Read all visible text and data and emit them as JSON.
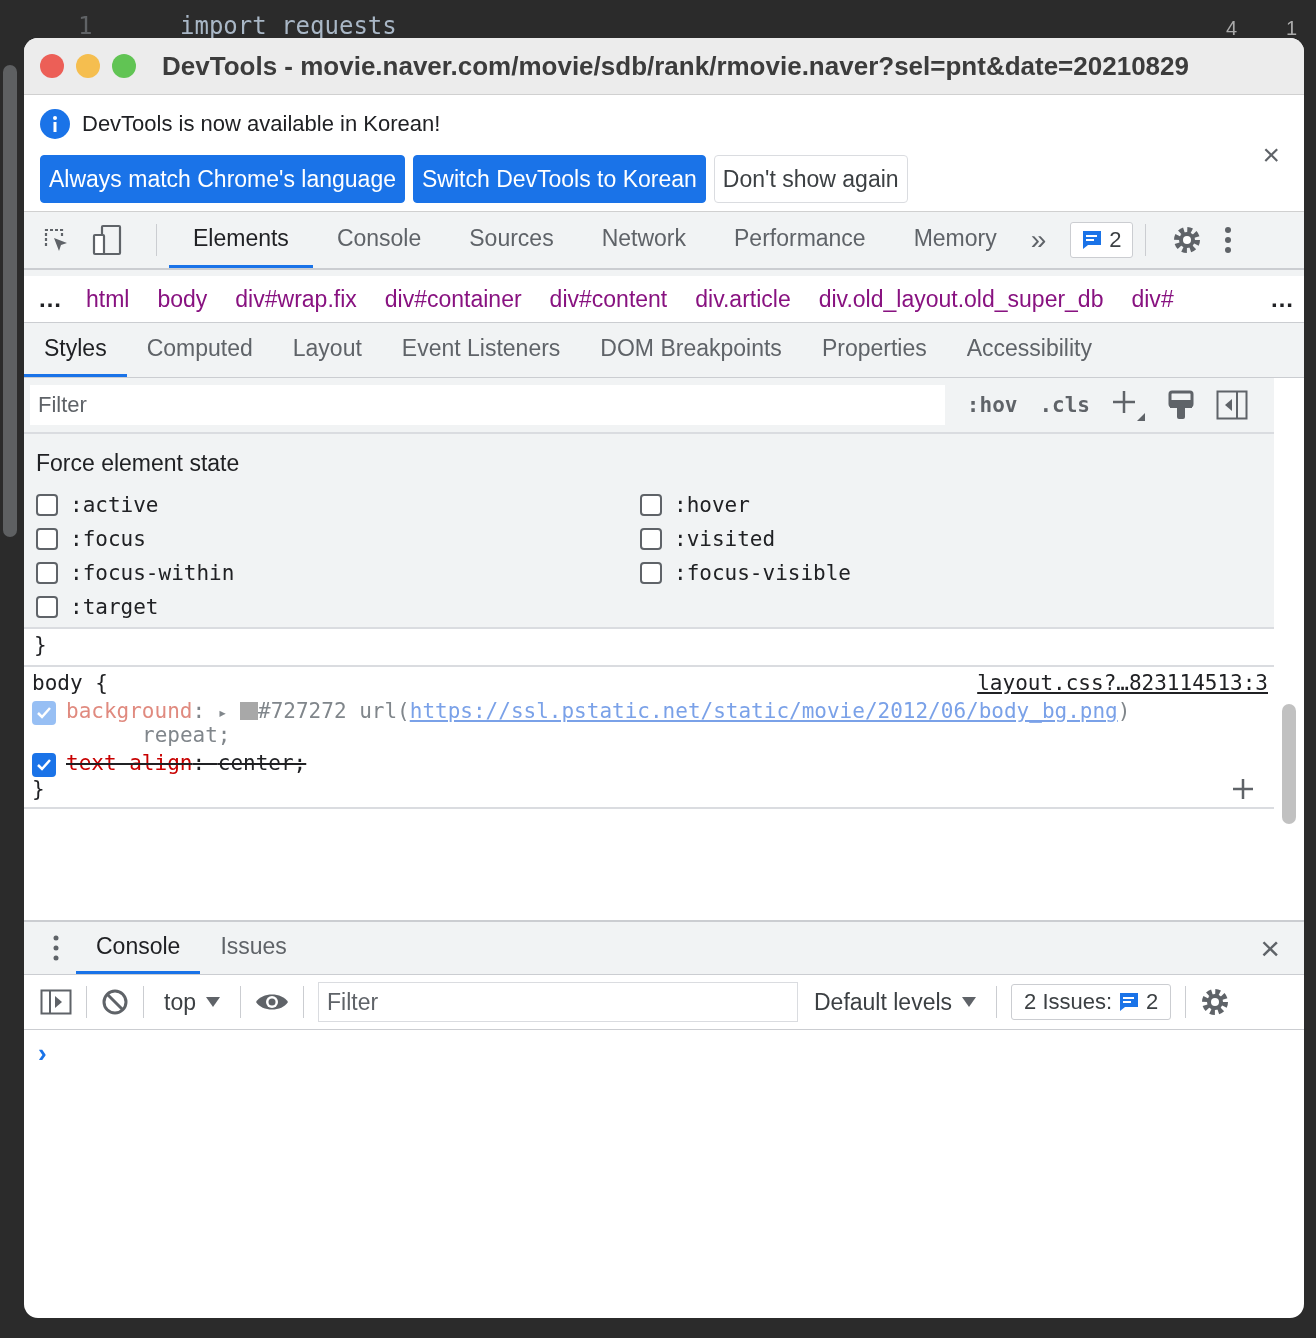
{
  "editor": {
    "line_number": "1",
    "code_top": "import requests",
    "warnings": "4",
    "checks": "1"
  },
  "window": {
    "title": "DevTools - movie.naver.com/movie/sdb/rank/rmovie.naver?sel=pnt&date=20210829"
  },
  "infobar": {
    "message": "DevTools is now available in Korean!",
    "buttons": [
      {
        "label": "Always match Chrome's language",
        "kind": "primary"
      },
      {
        "label": "Switch DevTools to Korean",
        "kind": "primary"
      },
      {
        "label": "Don't show again",
        "kind": "secondary"
      }
    ],
    "close": "×"
  },
  "tabs": [
    {
      "label": "Elements",
      "selected": true
    },
    {
      "label": "Console",
      "selected": false
    },
    {
      "label": "Sources",
      "selected": false
    },
    {
      "label": "Network",
      "selected": false
    },
    {
      "label": "Performance",
      "selected": false
    },
    {
      "label": "Memory",
      "selected": false
    }
  ],
  "tabs_more": "»",
  "issues_badge": "2",
  "breadcrumbs": {
    "more_left": "…",
    "more_right": "…",
    "items": [
      {
        "tag": "html"
      },
      {
        "tag": "body"
      },
      {
        "tag": "div",
        "rest": "#wrap.fix"
      },
      {
        "tag": "div",
        "rest": "#container"
      },
      {
        "tag": "div",
        "rest": "#content"
      },
      {
        "tag": "div",
        "rest": ".article"
      },
      {
        "tag": "div",
        "rest": ".old_layout.old_super_db"
      },
      {
        "tag": "div",
        "rest": "#"
      }
    ]
  },
  "subtabs": [
    {
      "label": "Styles",
      "selected": true
    },
    {
      "label": "Computed",
      "selected": false
    },
    {
      "label": "Layout",
      "selected": false
    },
    {
      "label": "Event Listeners",
      "selected": false
    },
    {
      "label": "DOM Breakpoints",
      "selected": false
    },
    {
      "label": "Properties",
      "selected": false
    },
    {
      "label": "Accessibility",
      "selected": false
    }
  ],
  "styles_toolbar": {
    "filter_placeholder": "Filter",
    "hov": ":hov",
    "cls": ".cls"
  },
  "force_state": {
    "title": "Force element state",
    "states": [
      {
        "label": ":active",
        "checked": false
      },
      {
        "label": ":hover",
        "checked": false
      },
      {
        "label": ":focus",
        "checked": false
      },
      {
        "label": ":visited",
        "checked": false
      },
      {
        "label": ":focus-within",
        "checked": false
      },
      {
        "label": ":focus-visible",
        "checked": false
      },
      {
        "label": ":target",
        "checked": false
      }
    ]
  },
  "rules": {
    "previous_close": "}",
    "selector": "body {",
    "source": "layout.css?…823114513:3",
    "properties": [
      {
        "kind": "color",
        "name": "background",
        "separator": ":",
        "expander": "▸",
        "value_before": "#727272 url(",
        "link": "https://ssl.pstatic.net/static/movie/2012/06/body_bg.png",
        "value_after": ")",
        "continuation": "repeat;",
        "checked": true,
        "inactive": true,
        "overridden": false
      },
      {
        "kind": "plain",
        "name": "text-align",
        "separator": ":",
        "value_before": "center;",
        "checked": true,
        "inactive": false,
        "overridden": true
      }
    ],
    "close": "}"
  },
  "drawer": {
    "tabs": [
      {
        "label": "Console",
        "selected": true
      },
      {
        "label": "Issues",
        "selected": false
      }
    ],
    "close": "×",
    "context": "top",
    "filter_placeholder": "Filter",
    "levels": "Default levels",
    "issues_label": "2 Issues:",
    "issues_count": "2",
    "prompt": "›"
  }
}
